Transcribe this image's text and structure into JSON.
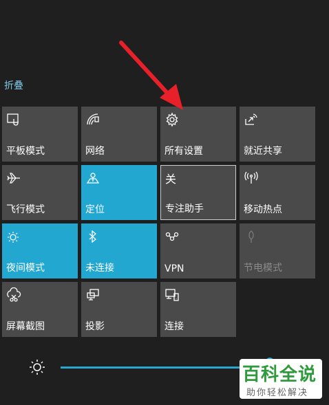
{
  "panel": {
    "collapse_label": "折叠"
  },
  "tiles": [
    {
      "label": "平板模式",
      "icon": "tablet-mode-icon",
      "state": "off"
    },
    {
      "label": "网络",
      "icon": "network-icon",
      "state": "off"
    },
    {
      "label": "所有设置",
      "icon": "settings-gear-icon",
      "state": "off"
    },
    {
      "label": "就近共享",
      "icon": "nearby-share-icon",
      "state": "off"
    },
    {
      "label": "飞行模式",
      "icon": "airplane-icon",
      "state": "off"
    },
    {
      "label": "定位",
      "icon": "location-icon",
      "state": "on"
    },
    {
      "label": "专注助手",
      "icon_text": "关",
      "icon": "focus-assist-icon",
      "state": "off"
    },
    {
      "label": "移动热点",
      "icon": "hotspot-icon",
      "state": "off"
    },
    {
      "label": "夜间模式",
      "icon": "night-light-icon",
      "state": "on"
    },
    {
      "label": "未连接",
      "icon": "bluetooth-icon",
      "state": "on"
    },
    {
      "label": "VPN",
      "icon": "vpn-icon",
      "state": "off"
    },
    {
      "label": "节电模式",
      "icon": "battery-saver-icon",
      "state": "disabled"
    },
    {
      "label": "屏幕截图",
      "icon": "screen-snip-icon",
      "state": "off"
    },
    {
      "label": "投影",
      "icon": "project-icon",
      "state": "off"
    },
    {
      "label": "连接",
      "icon": "connect-icon",
      "state": "off"
    }
  ],
  "brightness": {
    "icon": "brightness-icon",
    "level": 0.98
  },
  "watermark": {
    "title": "百科全说",
    "subtitle": "助你轻松解决"
  },
  "colors": {
    "accent": "#21a7d0",
    "tile": "#4a4a4a",
    "background": "#1f1f1f",
    "arrow": "#e8202a"
  }
}
